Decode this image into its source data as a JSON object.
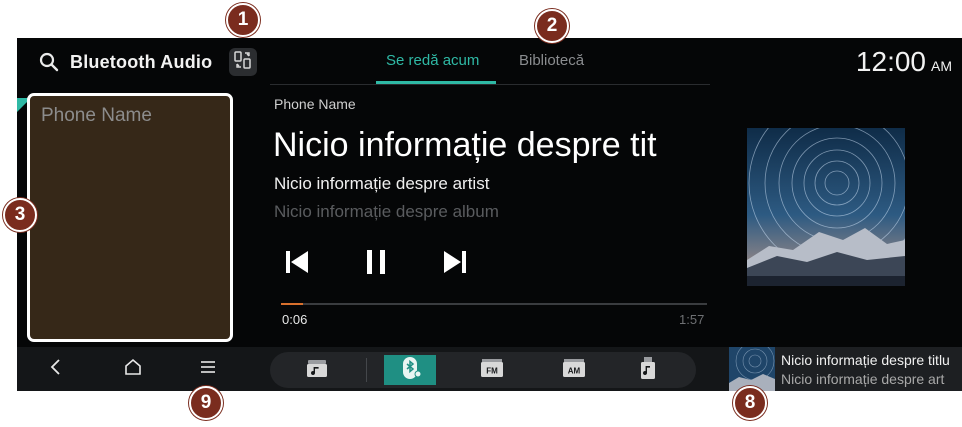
{
  "header": {
    "search_icon": "search-icon",
    "source_title": "Bluetooth Audio",
    "switch_icon": "device-switch-icon"
  },
  "tabs": [
    {
      "label": "Se redă acum",
      "active": true
    },
    {
      "label": "Bibliotecă",
      "active": false
    }
  ],
  "clock": {
    "time": "12:00",
    "ampm": "AM"
  },
  "phone_panel": {
    "label": "Phone Name"
  },
  "now_playing": {
    "device": "Phone Name",
    "title": "Nicio informație despre tit",
    "artist": "Nicio informație despre artist",
    "album": "Nicio informație despre album",
    "elapsed": "0:06",
    "total": "1:57",
    "progress_fraction": 0.051
  },
  "controls": [
    "previous-icon",
    "pause-icon",
    "next-icon"
  ],
  "nav": [
    "back-icon",
    "home-icon",
    "menu-icon"
  ],
  "sources": [
    "media-icon",
    "bluetooth-audio-icon",
    "fm-icon",
    "am-icon",
    "usb-music-icon"
  ],
  "mini_player": {
    "title": "Nicio informație despre titlu",
    "subtitle": "Nicio informație despre art"
  },
  "callouts": [
    "1",
    "2",
    "3",
    "8",
    "9"
  ],
  "colors": {
    "accent": "#2fb9a5",
    "progress": "#d9702d",
    "callout": "#7a2c1e",
    "panel": "#362818"
  }
}
